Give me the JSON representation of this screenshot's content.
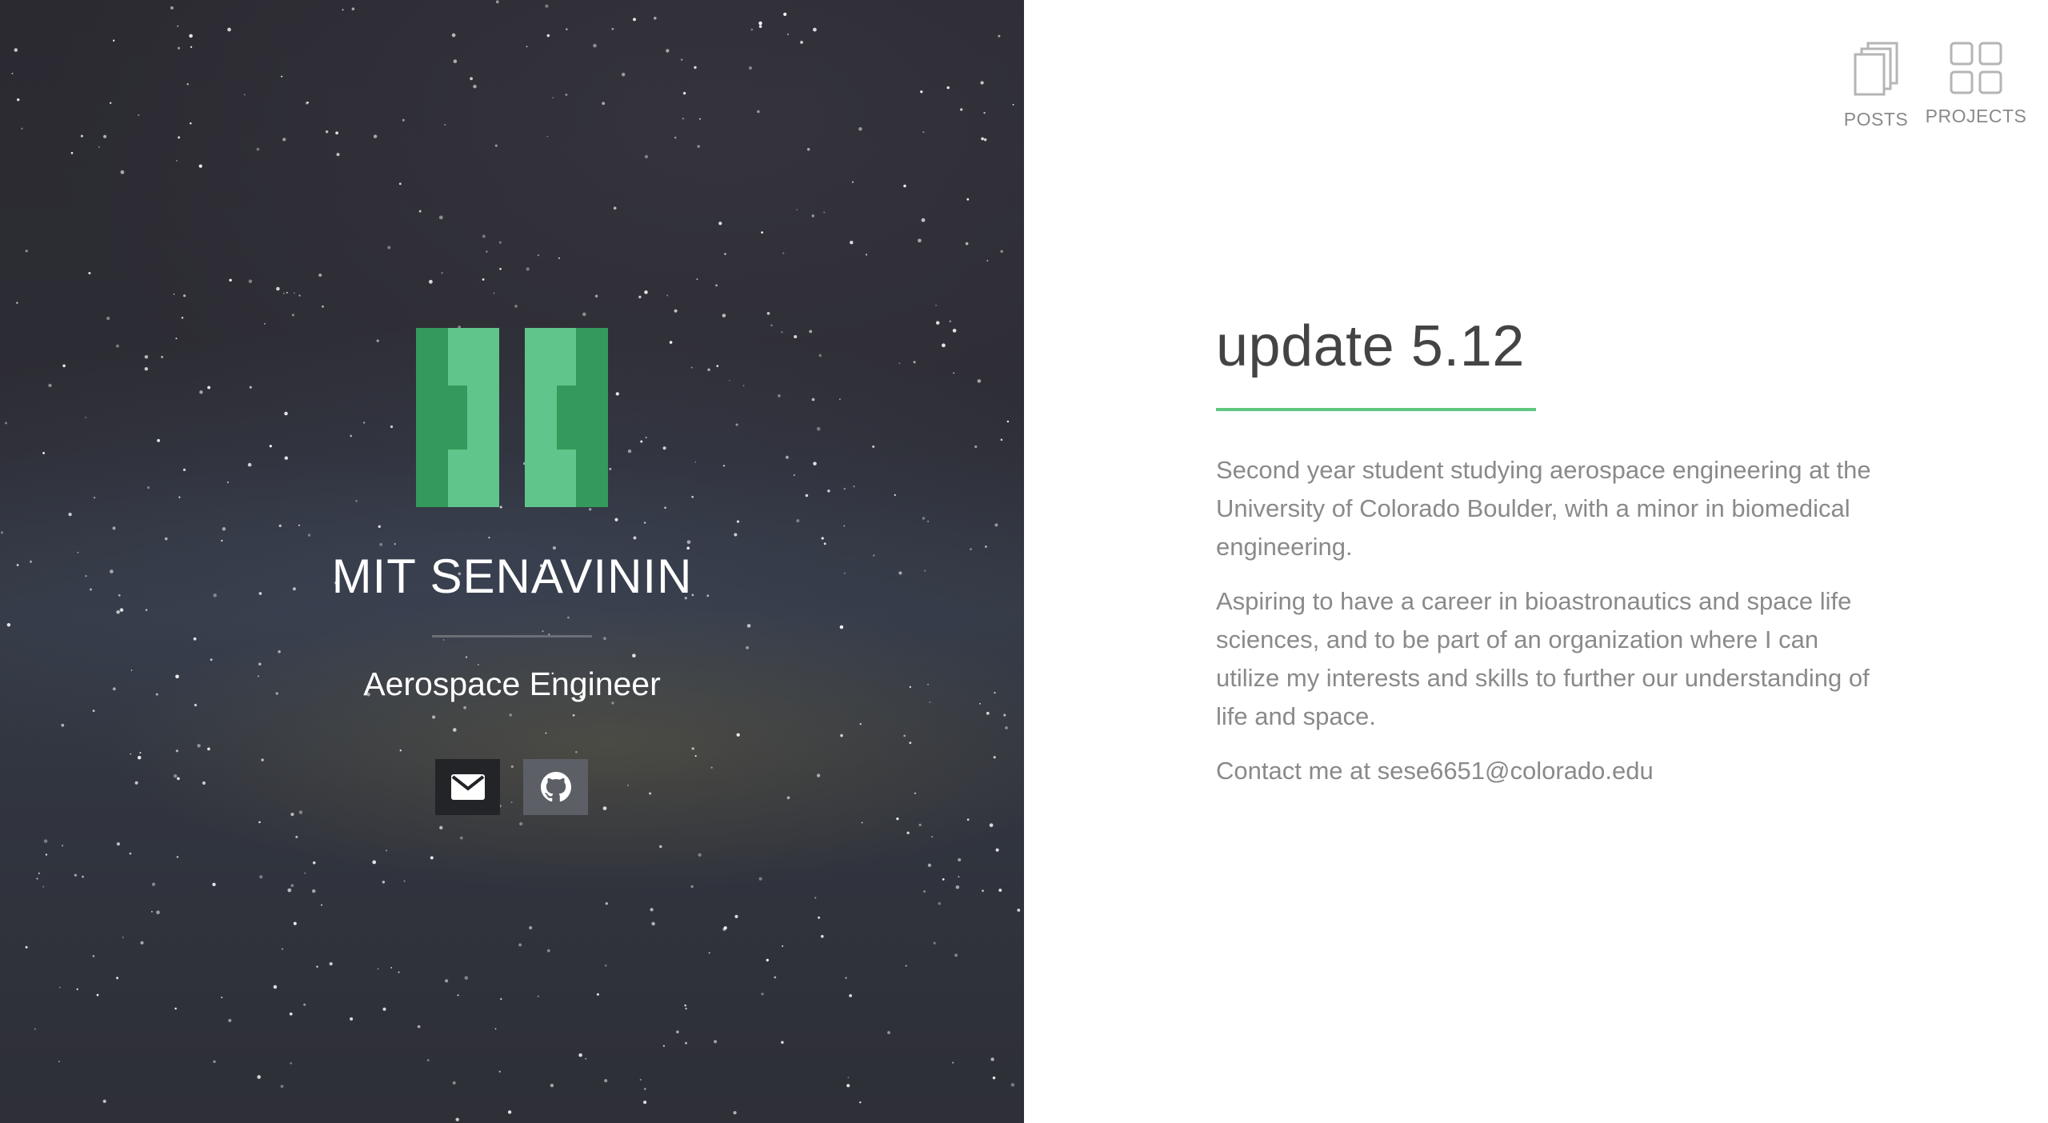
{
  "hero": {
    "name": "MIT SENAVININ",
    "subtitle": "Aerospace Engineer",
    "logo_icon": "hh-monogram-logo",
    "logo_colors": [
      "#349a5b",
      "#60c58a"
    ],
    "social": [
      {
        "icon": "envelope-icon"
      },
      {
        "icon": "github-icon"
      }
    ]
  },
  "nav": {
    "posts_label": "POSTS",
    "projects_label": "PROJECTS"
  },
  "post": {
    "title": "update 5.12",
    "paragraphs": [
      "Second year student studying aerospace engineering at the University of Colorado Boulder, with a minor in biomedical engineering.",
      "Aspiring to have a career in bioastronautics and space life sciences, and to be part of an organization where I can utilize my interests and skills to further our understanding of life and space.",
      "Contact me at sese6651@colorado.edu"
    ],
    "accent_color": "#5fc67f"
  }
}
